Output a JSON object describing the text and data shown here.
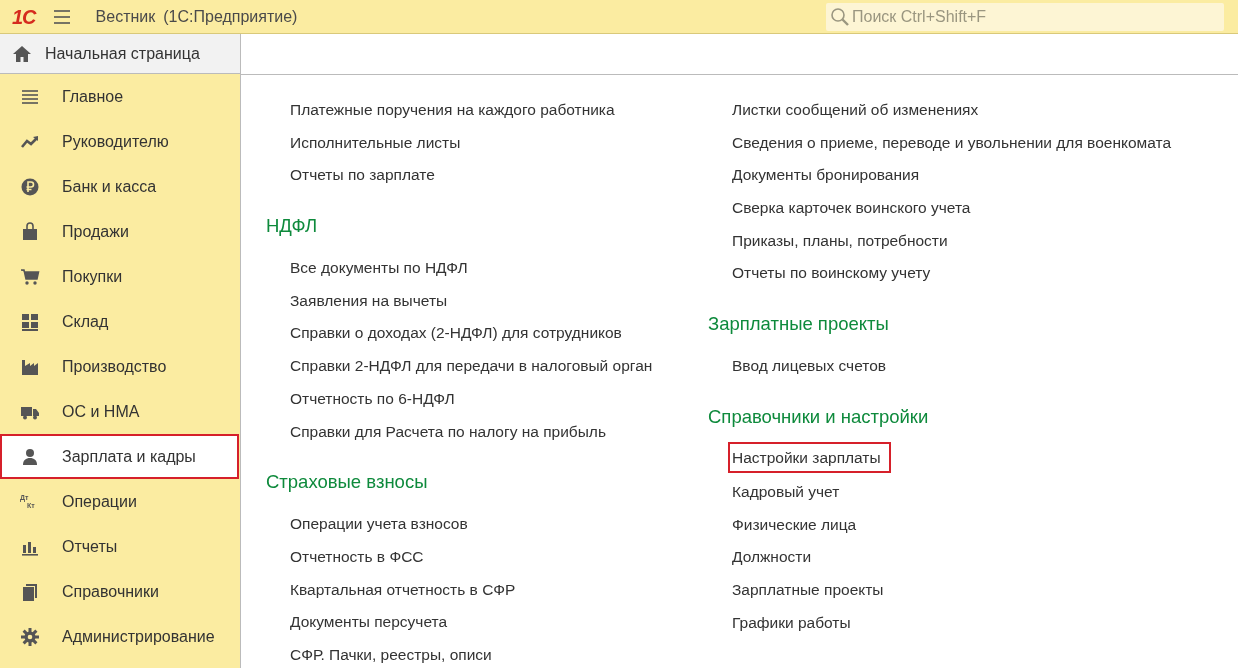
{
  "title_bar": {
    "logo": "1С",
    "app_title": "Вестник",
    "app_subtitle": "(1С:Предприятие)",
    "search": {
      "placeholder": "Поиск Ctrl+Shift+F"
    }
  },
  "home_tab": {
    "label": "Начальная страница"
  },
  "sidebar": {
    "items": [
      {
        "label": "Главное",
        "kind": "menu",
        "selected": false,
        "highlighted": false
      },
      {
        "label": "Руководителю",
        "kind": "trend",
        "selected": false,
        "highlighted": false
      },
      {
        "label": "Банк и касса",
        "kind": "ruble",
        "selected": false,
        "highlighted": false
      },
      {
        "label": "Продажи",
        "kind": "bag",
        "selected": false,
        "highlighted": false
      },
      {
        "label": "Покупки",
        "kind": "cart",
        "selected": false,
        "highlighted": false
      },
      {
        "label": "Склад",
        "kind": "warehouse",
        "selected": false,
        "highlighted": false
      },
      {
        "label": "Производство",
        "kind": "factory",
        "selected": false,
        "highlighted": false
      },
      {
        "label": "ОС и НМА",
        "kind": "truck",
        "selected": false,
        "highlighted": false
      },
      {
        "label": "Зарплата и кадры",
        "kind": "person",
        "selected": true,
        "highlighted": true
      },
      {
        "label": "Операции",
        "kind": "debit-credit",
        "icon_text": [
          "Дт",
          "Кт"
        ],
        "selected": false,
        "highlighted": false
      },
      {
        "label": "Отчеты",
        "kind": "chart",
        "selected": false,
        "highlighted": false
      },
      {
        "label": "Справочники",
        "kind": "books",
        "selected": false,
        "highlighted": false
      },
      {
        "label": "Администрирование",
        "kind": "gear",
        "selected": false,
        "highlighted": false
      }
    ]
  },
  "content": {
    "columns": [
      {
        "sections": [
          {
            "links": [
              {
                "label": "Платежные поручения на каждого работника",
                "highlighted": false
              },
              {
                "label": "Исполнительные листы",
                "highlighted": false
              },
              {
                "label": "Отчеты по зарплате",
                "highlighted": false
              }
            ]
          },
          {
            "heading": "НДФЛ",
            "links": [
              {
                "label": "Все документы по НДФЛ",
                "highlighted": false
              },
              {
                "label": "Заявления на вычеты",
                "highlighted": false
              },
              {
                "label": "Справки о доходах (2-НДФЛ) для сотрудников",
                "highlighted": false
              },
              {
                "label": "Справки 2-НДФЛ для передачи в налоговый орган",
                "highlighted": false
              },
              {
                "label": "Отчетность по 6-НДФЛ",
                "highlighted": false
              },
              {
                "label": "Справки для Расчета по налогу на прибыль",
                "highlighted": false
              }
            ]
          },
          {
            "heading": "Страховые взносы",
            "links": [
              {
                "label": "Операции учета взносов",
                "highlighted": false
              },
              {
                "label": "Отчетность в ФСС",
                "highlighted": false
              },
              {
                "label": "Квартальная отчетность в СФР",
                "highlighted": false
              },
              {
                "label": "Документы персучета",
                "highlighted": false
              },
              {
                "label": "СФР. Пачки, реестры, описи",
                "highlighted": false
              }
            ]
          }
        ]
      },
      {
        "sections": [
          {
            "links": [
              {
                "label": "Листки сообщений об изменениях",
                "highlighted": false
              },
              {
                "label": "Сведения о приеме, переводе и увольнении для военкомата",
                "highlighted": false
              },
              {
                "label": "Документы бронирования",
                "highlighted": false
              },
              {
                "label": "Сверка карточек воинского учета",
                "highlighted": false
              },
              {
                "label": "Приказы, планы, потребности",
                "highlighted": false
              },
              {
                "label": "Отчеты по воинскому учету",
                "highlighted": false
              }
            ]
          },
          {
            "heading": "Зарплатные проекты",
            "links": [
              {
                "label": "Ввод лицевых счетов",
                "highlighted": false
              }
            ]
          },
          {
            "heading": "Справочники и настройки",
            "links": [
              {
                "label": "Настройки зарплаты",
                "highlighted": true
              },
              {
                "label": "Кадровый учет",
                "highlighted": false
              },
              {
                "label": "Физические лица",
                "highlighted": false
              },
              {
                "label": "Должности",
                "highlighted": false
              },
              {
                "label": "Зарплатные проекты",
                "highlighted": false
              },
              {
                "label": "Графики работы",
                "highlighted": false
              }
            ]
          }
        ]
      }
    ]
  }
}
